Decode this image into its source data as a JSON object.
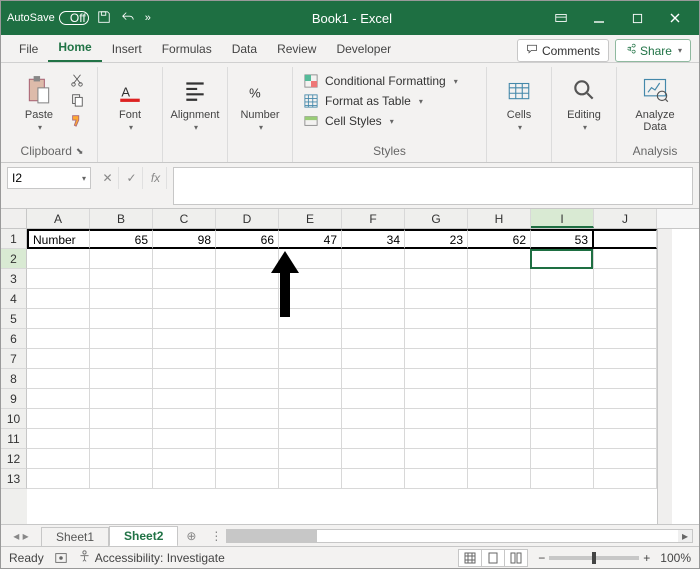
{
  "titlebar": {
    "autosave_label": "AutoSave",
    "autosave_state": "Off",
    "title": "Book1 - Excel"
  },
  "tabs": {
    "file": "File",
    "home": "Home",
    "insert": "Insert",
    "formulas": "Formulas",
    "data": "Data",
    "review": "Review",
    "developer": "Developer",
    "comments": "Comments",
    "share": "Share"
  },
  "ribbon": {
    "clipboard_label": "Clipboard",
    "paste_label": "Paste",
    "font_label": "Font",
    "alignment_label": "Alignment",
    "number_label": "Number",
    "styles_label": "Styles",
    "cond_fmt": "Conditional Formatting",
    "fmt_table": "Format as Table",
    "cell_styles": "Cell Styles",
    "cells_label": "Cells",
    "editing_label": "Editing",
    "analysis_label": "Analysis",
    "analyze_data": "Analyze Data"
  },
  "formula": {
    "name_box": "I2",
    "fx": "fx",
    "value": ""
  },
  "columns": [
    "A",
    "B",
    "C",
    "D",
    "E",
    "F",
    "G",
    "H",
    "I",
    "J"
  ],
  "row_numbers": [
    "1",
    "2",
    "3",
    "4",
    "5",
    "6",
    "7",
    "8",
    "9",
    "10",
    "11",
    "12",
    "13"
  ],
  "data_row": {
    "A": "Number",
    "B": "65",
    "C": "98",
    "D": "66",
    "E": "47",
    "F": "34",
    "G": "23",
    "H": "62",
    "I": "53"
  },
  "sheets": {
    "sheet1": "Sheet1",
    "sheet2": "Sheet2"
  },
  "status": {
    "ready": "Ready",
    "accessibility": "Accessibility: Investigate",
    "zoom": "100%"
  }
}
